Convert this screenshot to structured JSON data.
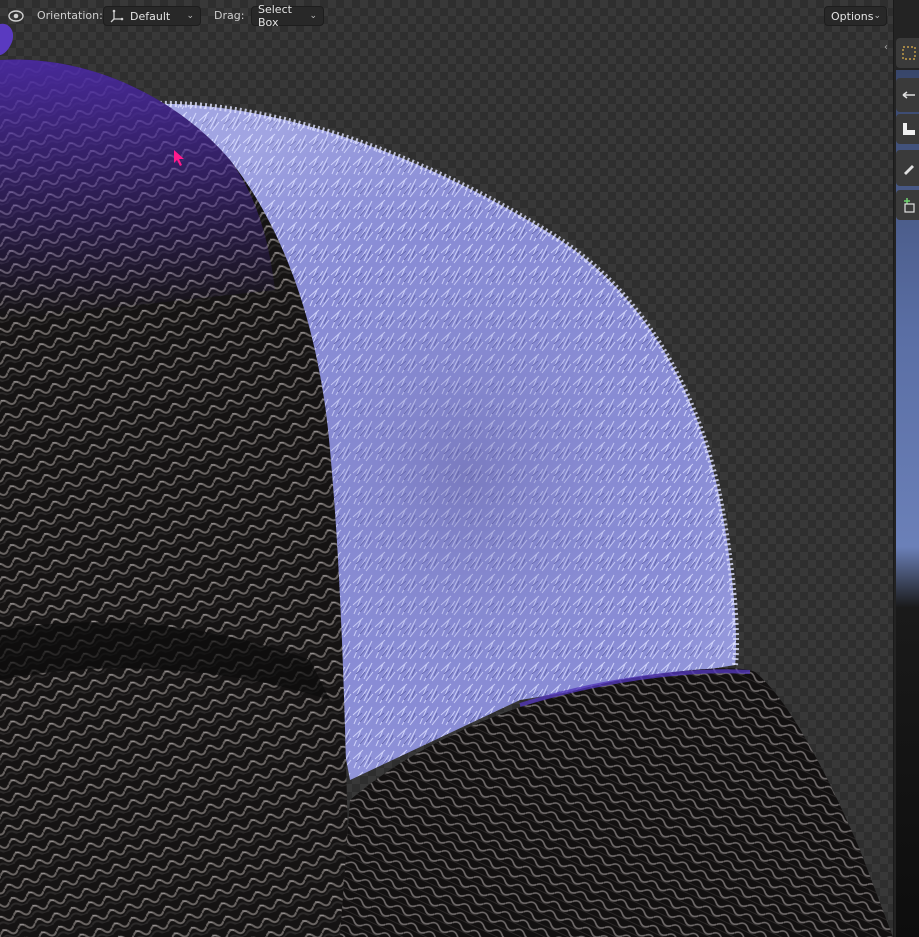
{
  "header": {
    "orientation_label": "Orientation:",
    "orientation_value": "Default",
    "drag_label": "Drag:",
    "drag_value": "Select Box",
    "options_label": "Options"
  },
  "icons": {
    "view_mode": "sculpt-view-icon",
    "orientation": "transform-orientation-icon",
    "dropdown": "chevron-down-icon",
    "panel_collapse": "chevron-left-icon"
  },
  "toolbar": {
    "tools": [
      {
        "name": "select-box-tool",
        "active": false
      },
      {
        "name": "move-tool",
        "active": false
      },
      {
        "name": "scale-tool",
        "active": false
      },
      {
        "name": "annotate-tool",
        "active": false
      },
      {
        "name": "add-cube-tool",
        "active": false
      }
    ]
  },
  "colors": {
    "viewport_bg": "#2e2e2e",
    "fur_light": "#b8bdf2",
    "fur_mid": "#7d7fcc",
    "fabric_dark": "#141212",
    "purple_accent": "#4a2a9a",
    "cursor": "#ff1a8c"
  }
}
